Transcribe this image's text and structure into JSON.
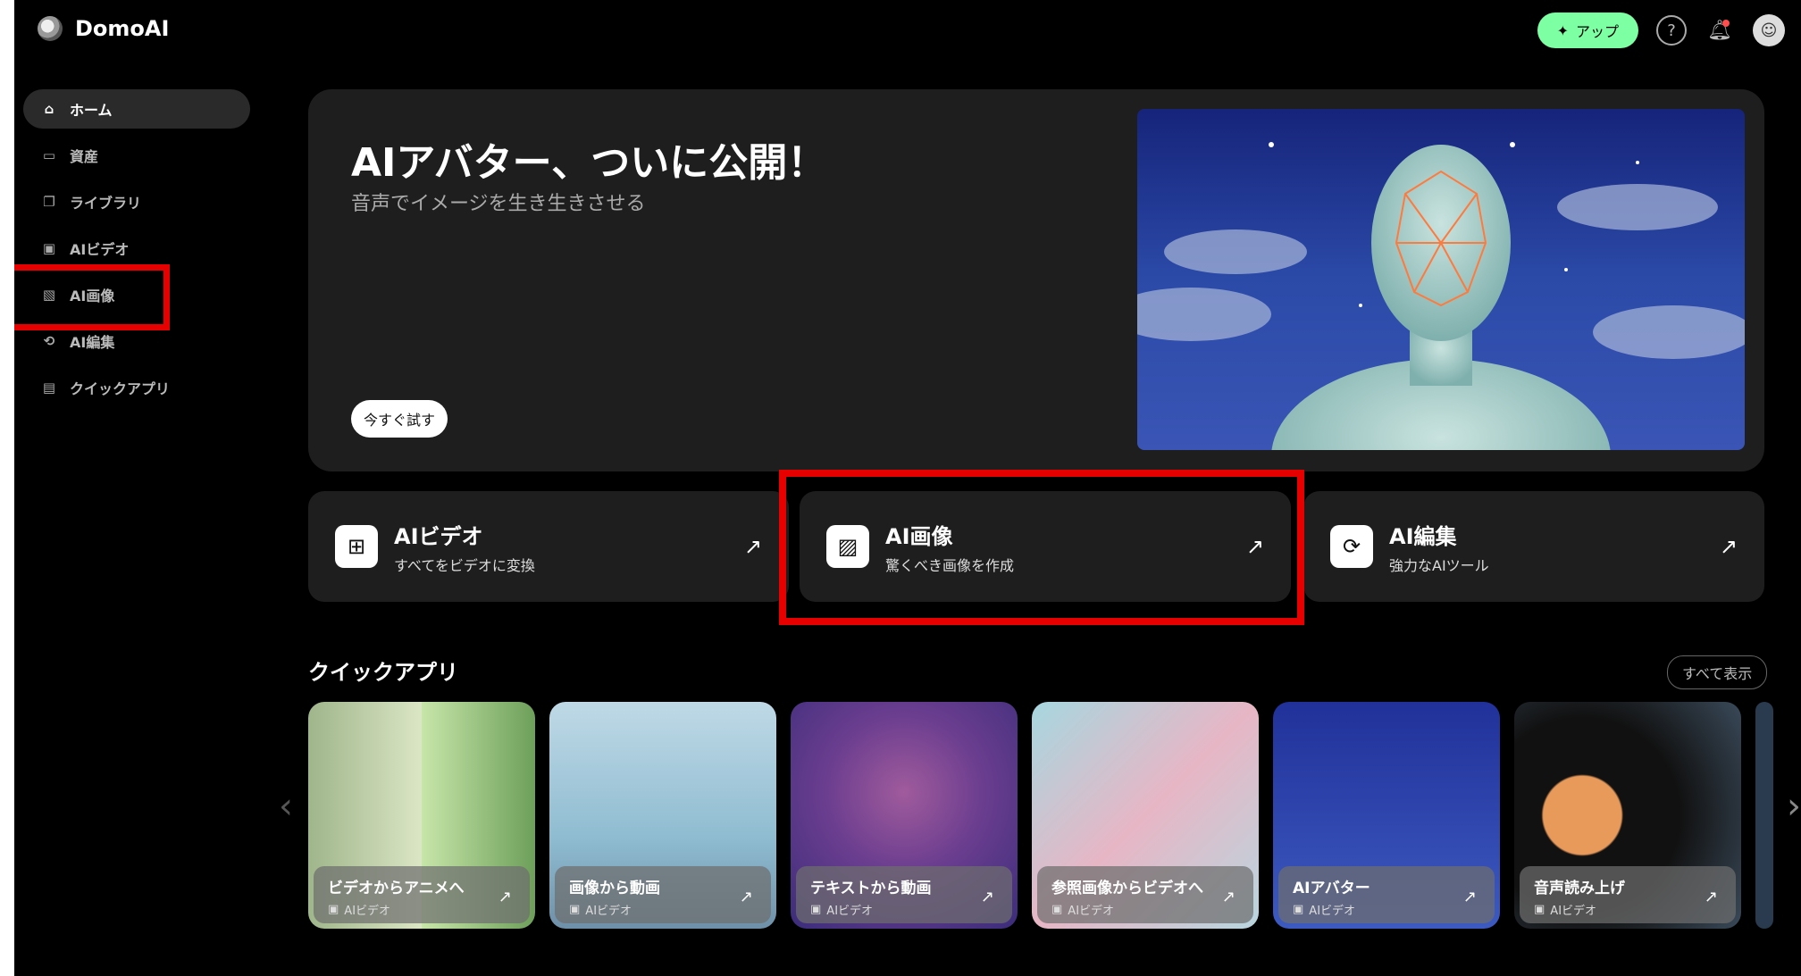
{
  "app": {
    "name": "DomoAI"
  },
  "topbar": {
    "upgrade_label": "アップ",
    "upgrade_icon": "sparkle-icon",
    "help_icon": "help-icon",
    "bell_icon": "bell-icon",
    "avatar_icon": "avatar"
  },
  "sidebar": {
    "items": [
      {
        "label": "ホーム",
        "icon": "home-icon",
        "active": true
      },
      {
        "label": "資産",
        "icon": "drive-icon"
      },
      {
        "label": "ライブラリ",
        "icon": "library-icon"
      },
      {
        "label": "AIビデオ",
        "icon": "video-icon"
      },
      {
        "label": "AI画像",
        "icon": "image-icon"
      },
      {
        "label": "AI編集",
        "icon": "edit-icon"
      },
      {
        "label": "クイックアプリ",
        "icon": "apps-icon"
      }
    ]
  },
  "hero": {
    "title": "AIアバター、ついに公開！",
    "subtitle": "音声でイメージを生き生きさせる",
    "button": "今すぐ試す"
  },
  "features": [
    {
      "title": "AIビデオ",
      "subtitle": "すべてをビデオに変換",
      "icon": "video-plus-icon"
    },
    {
      "title": "AI画像",
      "subtitle": "驚くべき画像を作成",
      "icon": "image-icon"
    },
    {
      "title": "AI編集",
      "subtitle": "強力なAIツール",
      "icon": "edit-icon"
    }
  ],
  "quick_apps": {
    "title": "クイックアプリ",
    "show_all": "すべて表示",
    "items": [
      {
        "name": "ビデオからアニメへ",
        "category": "AIビデオ"
      },
      {
        "name": "画像から動画",
        "category": "AIビデオ"
      },
      {
        "name": "テキストから動画",
        "category": "AIビデオ"
      },
      {
        "name": "参照画像からビデオへ",
        "category": "AIビデオ"
      },
      {
        "name": "AIアバター",
        "category": "AIビデオ"
      },
      {
        "name": "音声読み上げ",
        "category": "AIビデオ"
      }
    ]
  },
  "colors": {
    "highlight": "#e60000",
    "upgrade": "#7dffa3"
  }
}
